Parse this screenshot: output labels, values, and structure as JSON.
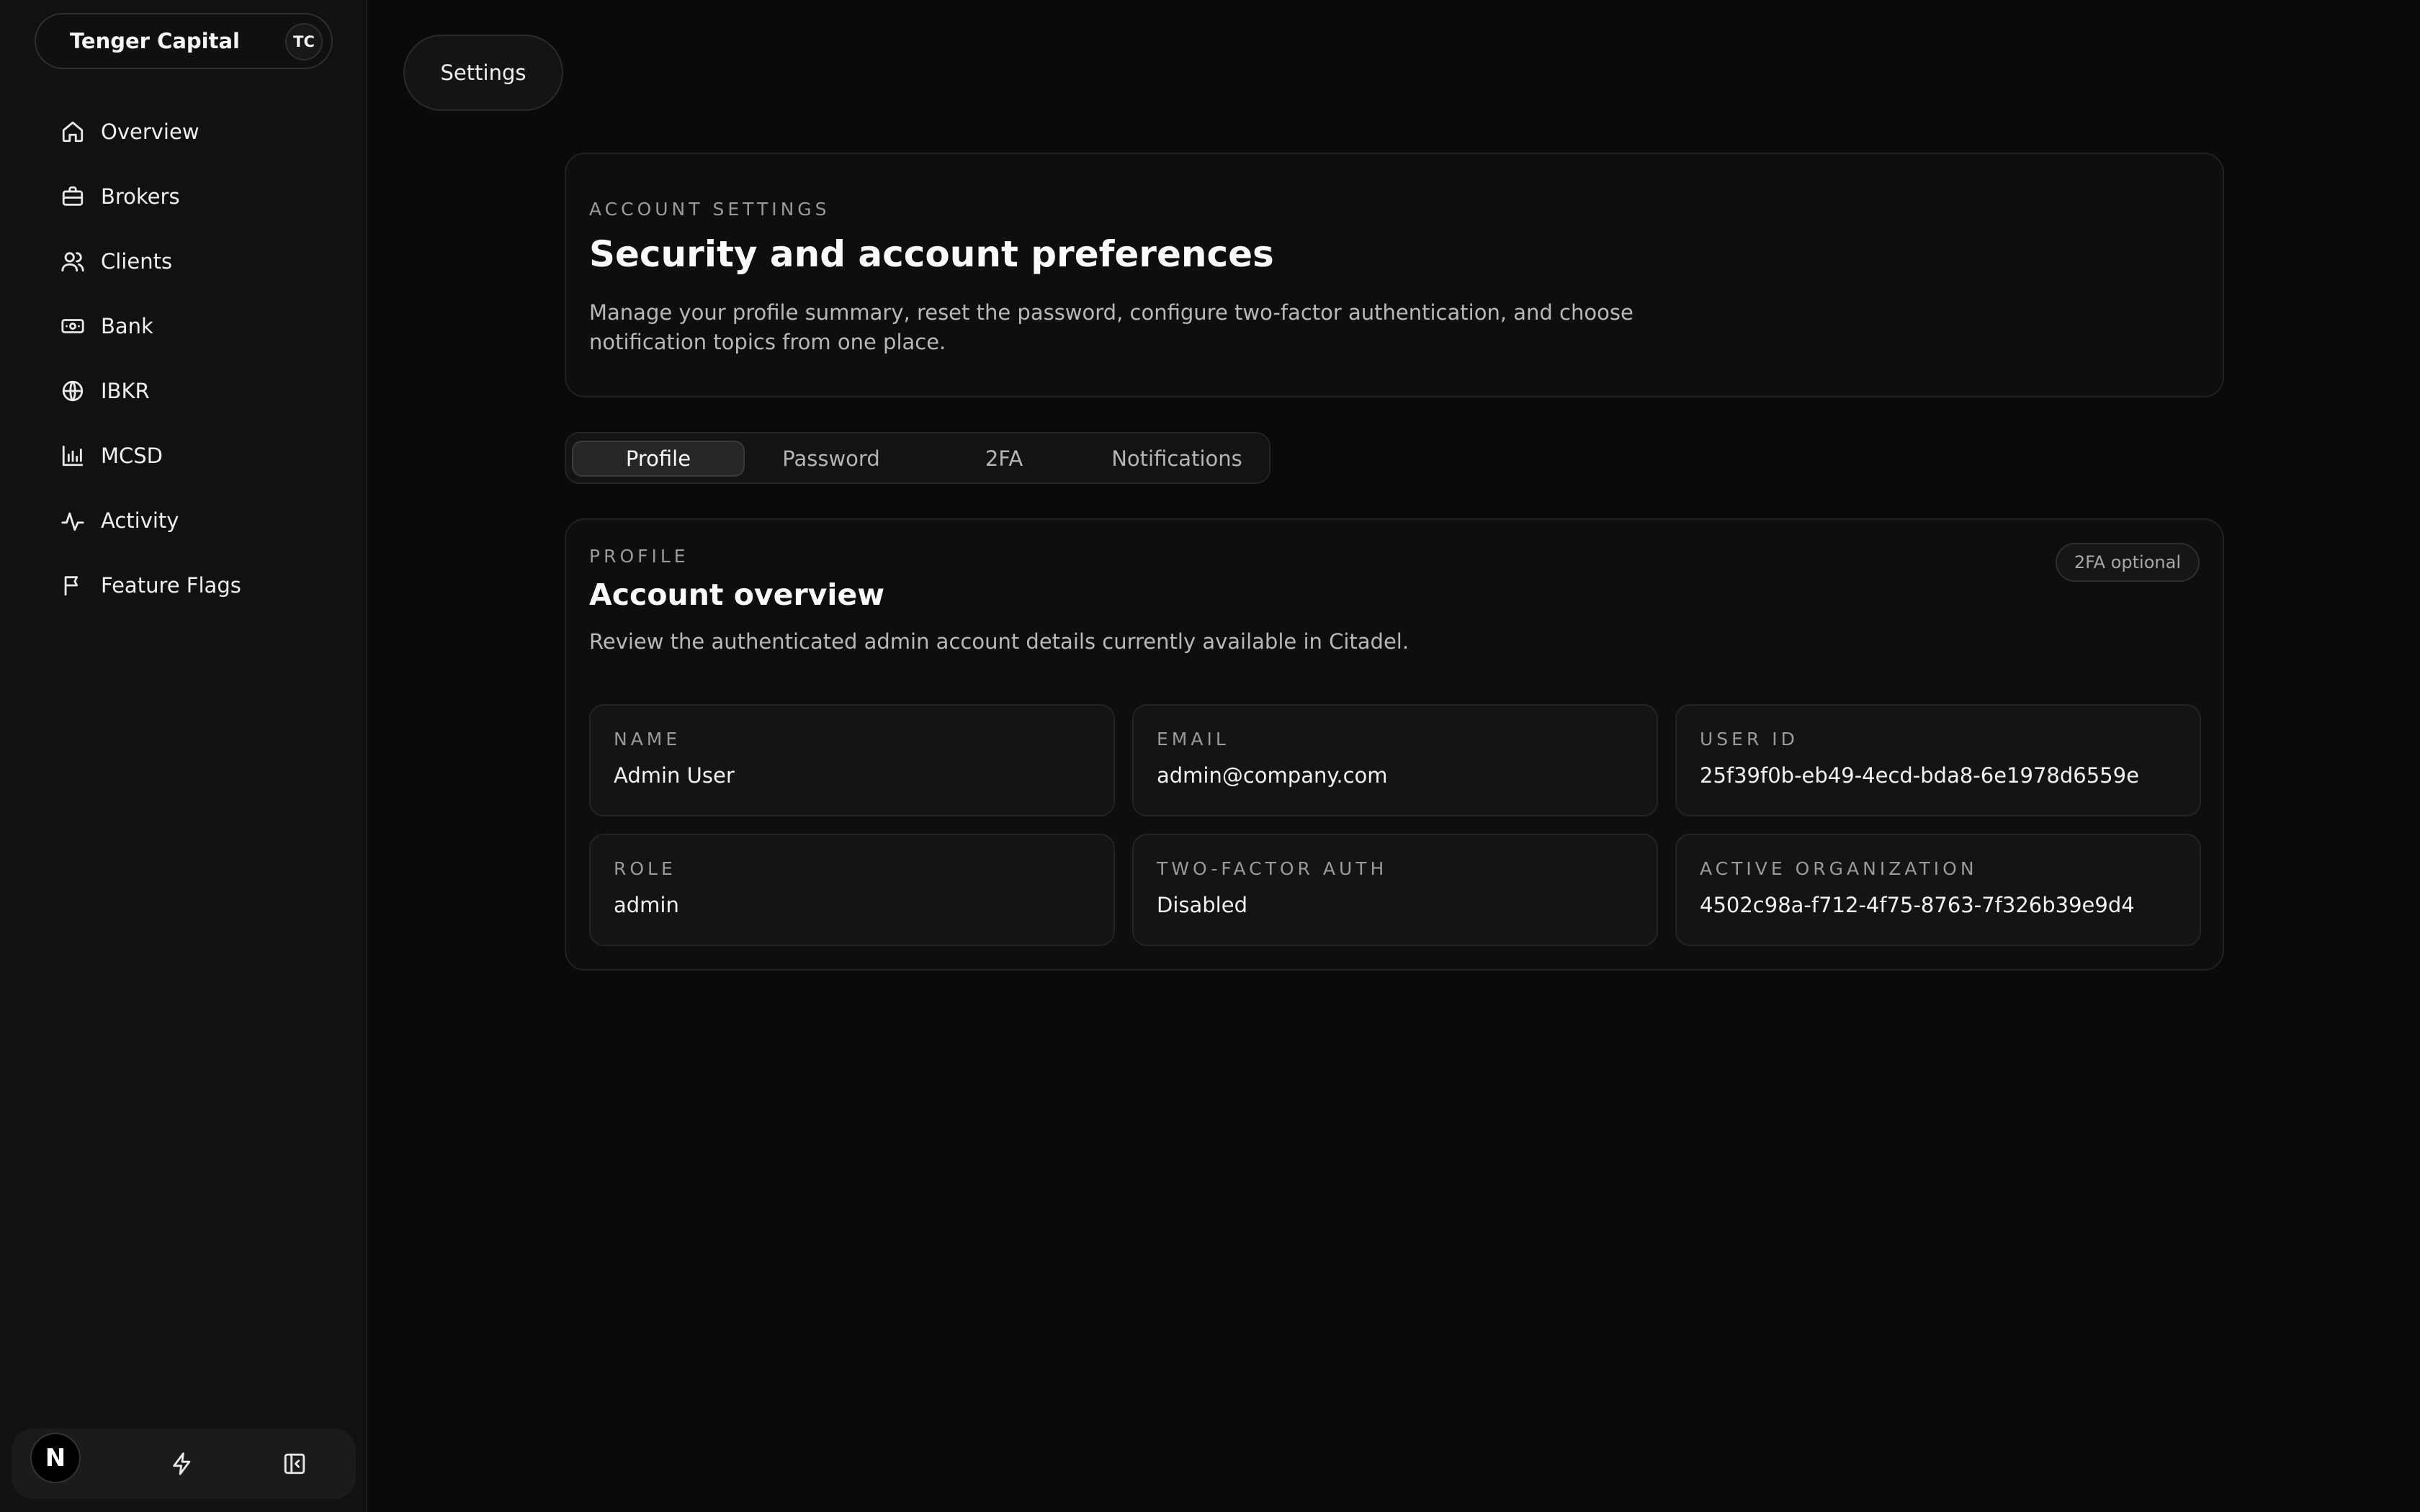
{
  "sidebar": {
    "org_name": "Tenger Capital",
    "org_initials": "TC",
    "items": [
      {
        "label": "Overview",
        "icon": "home-icon"
      },
      {
        "label": "Brokers",
        "icon": "briefcase-icon"
      },
      {
        "label": "Clients",
        "icon": "users-icon"
      },
      {
        "label": "Bank",
        "icon": "banknote-icon"
      },
      {
        "label": "IBKR",
        "icon": "globe-icon"
      },
      {
        "label": "MCSD",
        "icon": "bar-chart-icon"
      },
      {
        "label": "Activity",
        "icon": "activity-icon"
      },
      {
        "label": "Feature Flags",
        "icon": "flag-icon"
      }
    ],
    "bottom": {
      "badge": "N",
      "icons": [
        "bolt-icon",
        "collapse-sidebar-icon"
      ]
    }
  },
  "header": {
    "breadcrumb": "Settings"
  },
  "account": {
    "eyebrow": "ACCOUNT SETTINGS",
    "title": "Security and account preferences",
    "description": "Manage your profile summary, reset the password, configure two-factor authentication, and choose notification topics from one place."
  },
  "tabs": [
    {
      "label": "Profile",
      "active": true
    },
    {
      "label": "Password",
      "active": false
    },
    {
      "label": "2FA",
      "active": false
    },
    {
      "label": "Notifications",
      "active": false
    }
  ],
  "profile": {
    "eyebrow": "PROFILE",
    "title": "Account overview",
    "description": "Review the authenticated admin account details currently available in Citadel.",
    "badge": "2FA optional",
    "fields": [
      {
        "label": "NAME",
        "value": "Admin User"
      },
      {
        "label": "EMAIL",
        "value": "admin@company.com"
      },
      {
        "label": "USER ID",
        "value": "25f39f0b-eb49-4ecd-bda8-6e1978d6559e"
      },
      {
        "label": "ROLE",
        "value": "admin"
      },
      {
        "label": "TWO-FACTOR AUTH",
        "value": "Disabled"
      },
      {
        "label": "ACTIVE ORGANIZATION",
        "value": "4502c98a-f712-4f75-8763-7f326b39e9d4"
      }
    ]
  }
}
